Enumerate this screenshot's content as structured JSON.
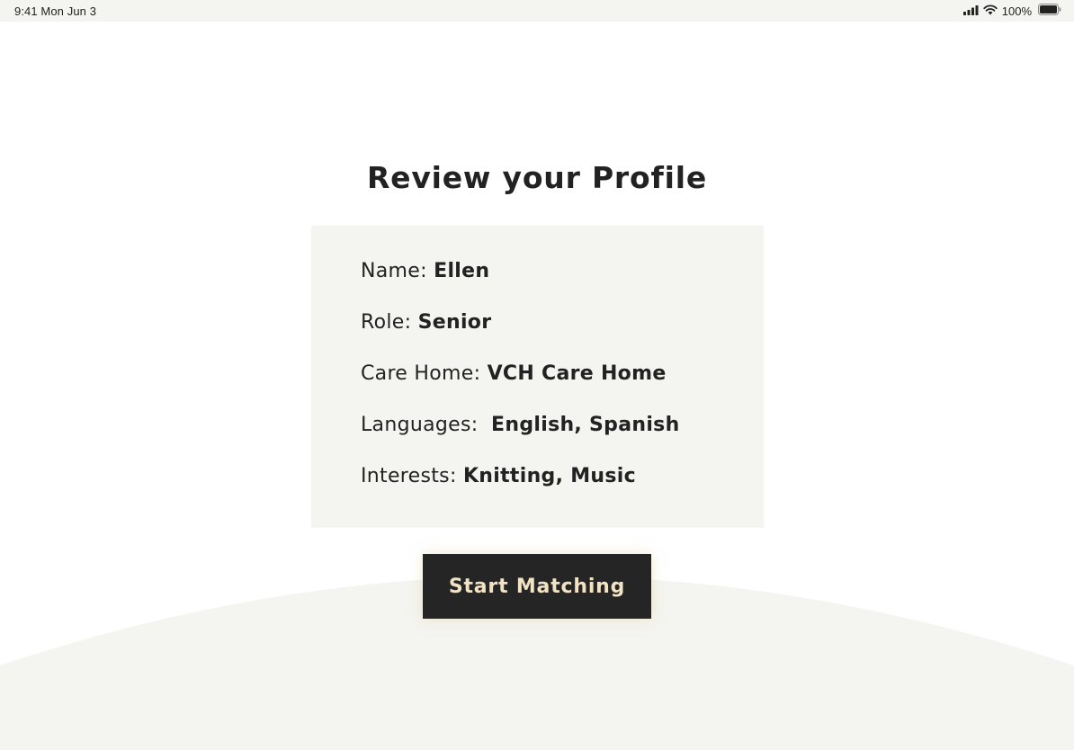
{
  "status_bar": {
    "time": "9:41",
    "date": "Mon Jun 3",
    "battery_percent": "100%",
    "icons": [
      "signal-icon",
      "wifi-icon",
      "battery-icon"
    ]
  },
  "page": {
    "title": "Review your Profile"
  },
  "profile": {
    "name_label": "Name: ",
    "name": "Ellen",
    "role_label": "Role: ",
    "role": "Senior",
    "care_home_label": "Care Home: ",
    "care_home": "VCH Care Home",
    "languages_label": "Languages:  ",
    "languages": "English, Spanish",
    "interests_label": "Interests: ",
    "interests": "Knitting, Music"
  },
  "actions": {
    "start_label": "Start Matching"
  },
  "colors": {
    "background": "#ffffff",
    "panel": "#f4f4f0",
    "text": "#222222",
    "button_bg": "#252525",
    "button_text": "#f1e3c3"
  }
}
